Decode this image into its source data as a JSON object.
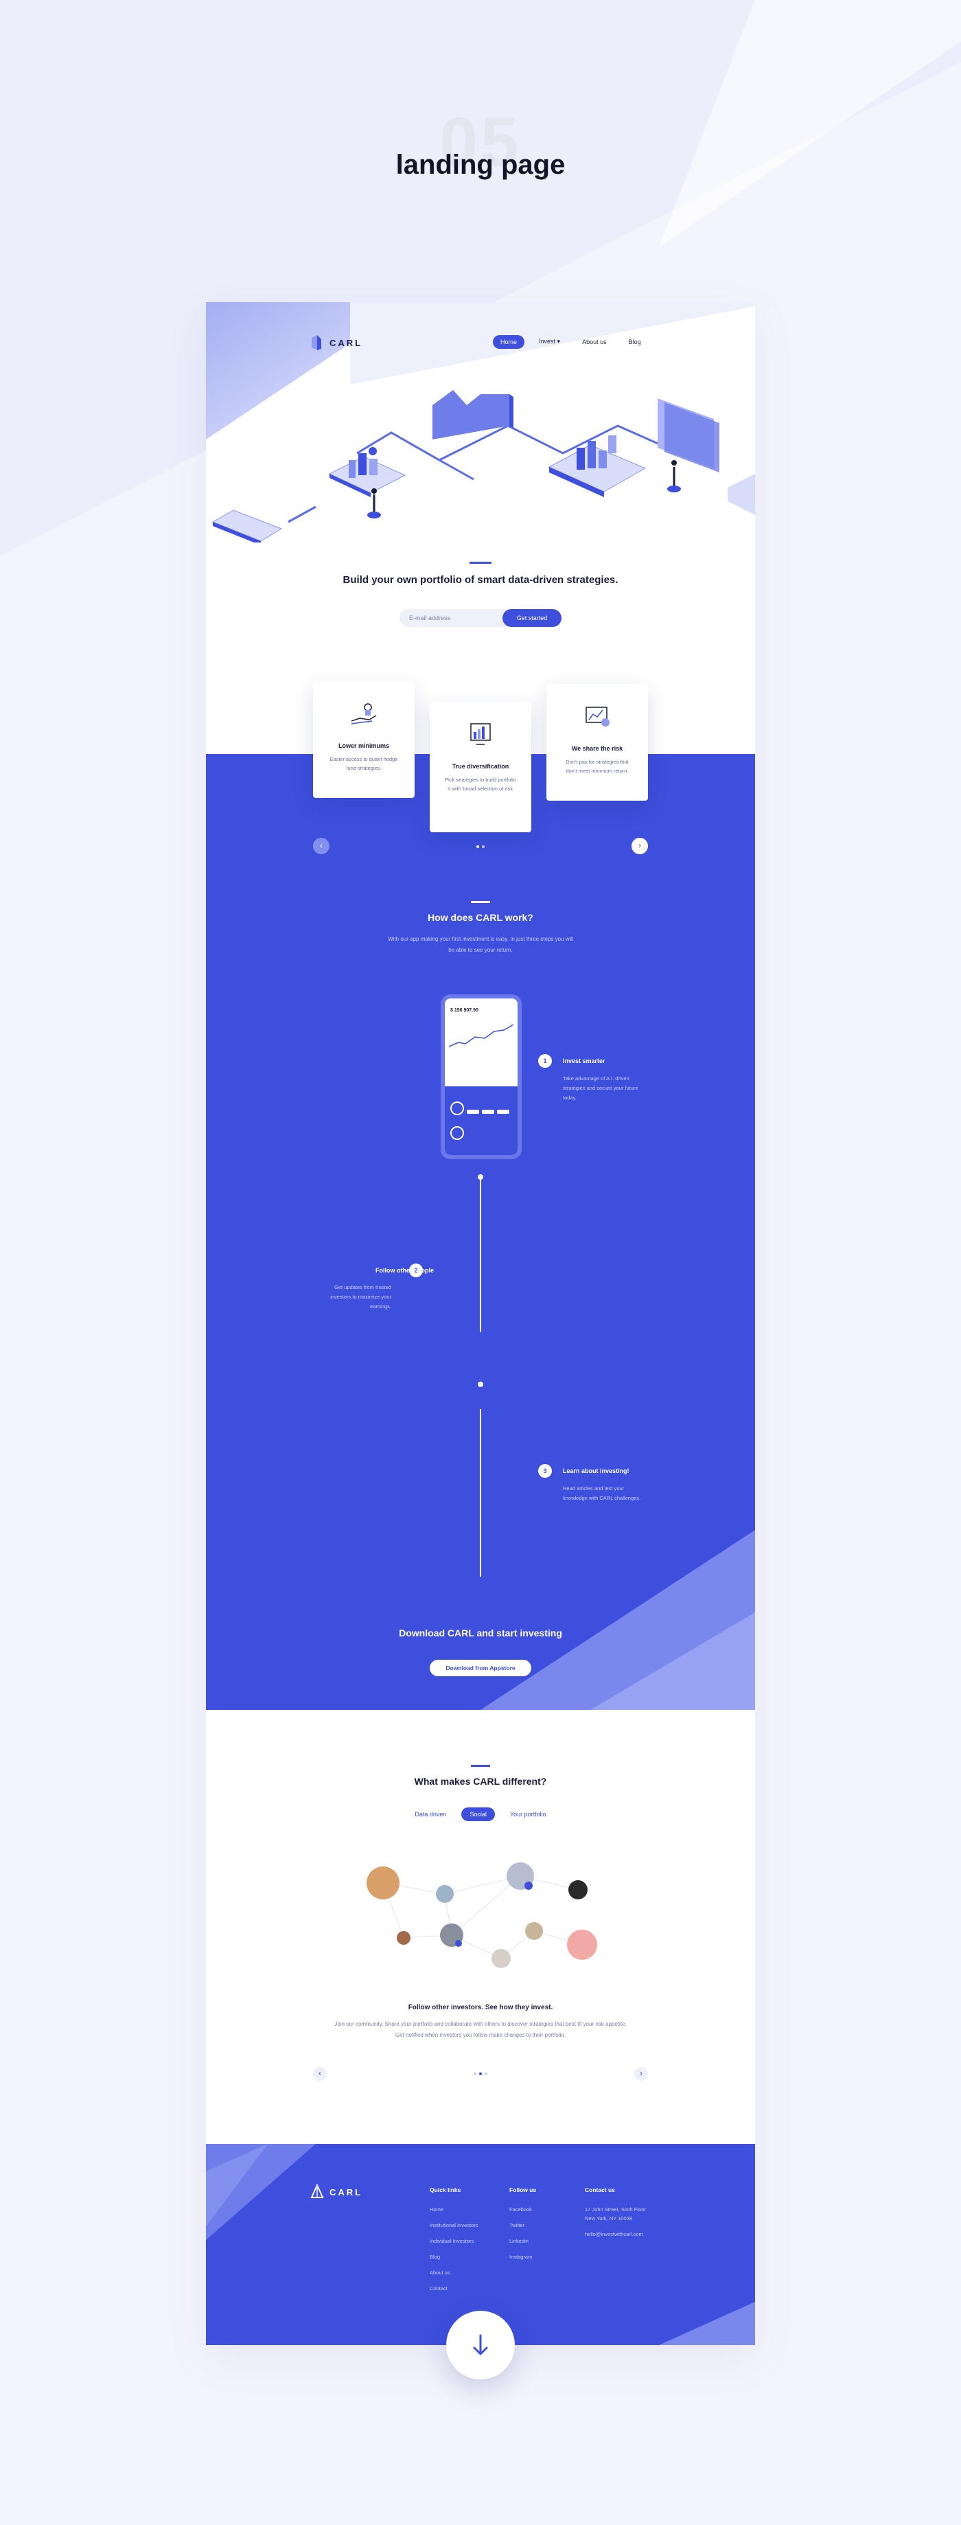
{
  "header": {
    "number": "05",
    "title": "landing page"
  },
  "colors": {
    "primary": "#3d4fdc",
    "background": "#f4f5fc",
    "white": "#ffffff",
    "text": "#1b1d3a"
  },
  "nav": {
    "brand": "CARL",
    "items": [
      {
        "label": "Home",
        "active": true
      },
      {
        "label": "Invest",
        "dropdown": true
      },
      {
        "label": "About us"
      },
      {
        "label": "Blog"
      }
    ]
  },
  "hero": {
    "title": "Build your own portfolio of smart data-driven strategies.",
    "email_placeholder": "E-mail address",
    "cta": "Get started"
  },
  "features": [
    {
      "title": "Lower minimums",
      "text": "Easier access to quant hedge fund strategies.",
      "icon": "hand-coins-icon"
    },
    {
      "title": "True diversification",
      "text": "Pick strategies to build portfolio s with broad selection of risk",
      "icon": "chart-screen-icon"
    },
    {
      "title": "We share the risk",
      "text": "Don't pay for strategies that don't meet minimum return.",
      "icon": "risk-chart-icon"
    }
  ],
  "how": {
    "title": "How does CARL work?",
    "subtitle": "With our app making your first investment is easy. In just three steps you will be able to see your return.",
    "phone": {
      "balance": "$ 156 907.90"
    },
    "steps": [
      {
        "num": "1",
        "title": "Invest smarter",
        "text": "Take advantage of A.I. driven strategies and secure your future today."
      },
      {
        "num": "2",
        "title": "Follow other people",
        "text": "Get updates from trusted investors to maximize your earnings."
      },
      {
        "num": "3",
        "title": "Learn about investing!",
        "text": "Read articles and test your knowledge with CARL challenges."
      }
    ]
  },
  "download": {
    "title": "Download CARL and start investing",
    "button": "Download from Appstore"
  },
  "different": {
    "title": "What makes CARL different?",
    "tabs": [
      {
        "label": "Data driven"
      },
      {
        "label": "Social",
        "active": true
      },
      {
        "label": "Your portfolio"
      }
    ],
    "follow_title": "Follow other investors. See how they invest.",
    "follow_text": "Join our community. Share your portfolio and collaborate with others to discover strategies that best fit your risk appetite. Get notified when investors you follow make changes to their portfolio."
  },
  "footer": {
    "brand": "CARL",
    "quick_links": {
      "title": "Quick links",
      "items": [
        "Home",
        "Institutional Investors",
        "Individual Investors",
        "Blog",
        "About us",
        "Contact"
      ]
    },
    "follow_us": {
      "title": "Follow us",
      "items": [
        "Facebook",
        "Twitter",
        "Linkedin",
        "Instagram"
      ]
    },
    "contact": {
      "title": "Contact us",
      "address1": "17 John Street, Sixth Floor",
      "address2": "New York, NY 10038",
      "email": "hello@investwithcarl.com"
    }
  }
}
